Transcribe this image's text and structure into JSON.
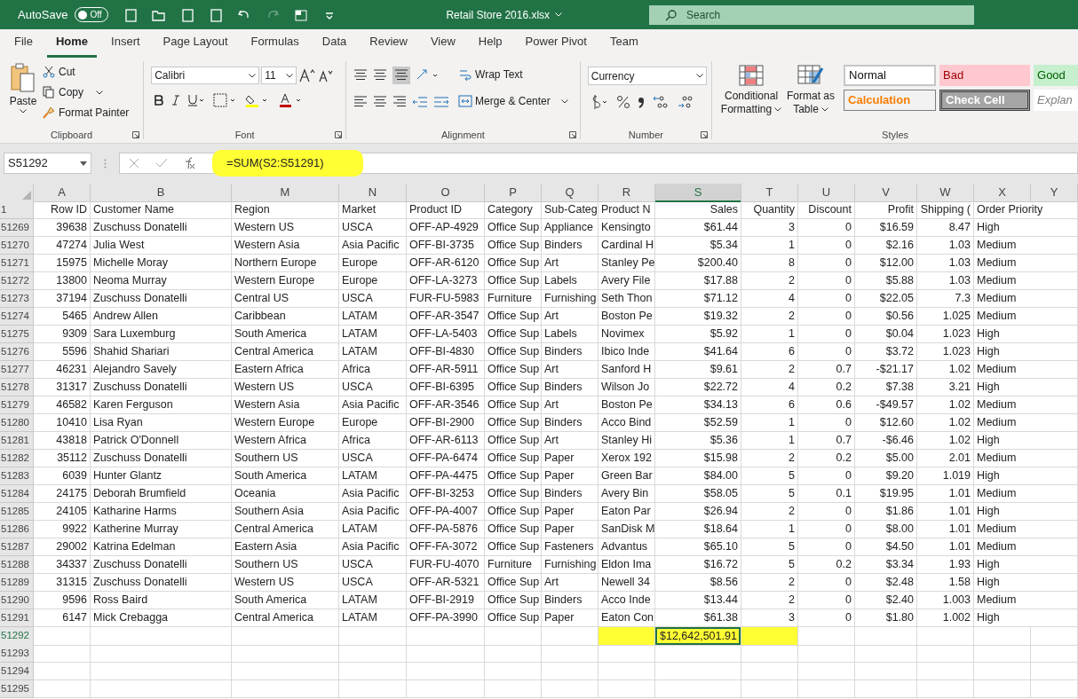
{
  "title_bar": {
    "autosave_label": "AutoSave",
    "autosave_on": false,
    "autosave_state": "Off",
    "title": "Retail Store 2016.xlsx",
    "search_placeholder": "Search"
  },
  "tabs": [
    {
      "label": "File",
      "selected": false
    },
    {
      "label": "Home",
      "selected": true
    },
    {
      "label": "Insert",
      "selected": false
    },
    {
      "label": "Page Layout",
      "selected": false
    },
    {
      "label": "Formulas",
      "selected": false
    },
    {
      "label": "Data",
      "selected": false
    },
    {
      "label": "Review",
      "selected": false
    },
    {
      "label": "View",
      "selected": false
    },
    {
      "label": "Help",
      "selected": false
    },
    {
      "label": "Power Pivot",
      "selected": false
    },
    {
      "label": "Team",
      "selected": false
    }
  ],
  "ribbon": {
    "clipboard": {
      "paste": "Paste",
      "cut": "Cut",
      "copy": "Copy",
      "format_painter": "Format Painter",
      "label": "Clipboard"
    },
    "font": {
      "font_name": "Calibri",
      "font_size": "11",
      "label": "Font"
    },
    "alignment": {
      "wrap_text": "Wrap Text",
      "merge": "Merge & Center",
      "label": "Alignment"
    },
    "number": {
      "format": "Currency",
      "label": "Number"
    },
    "styles": {
      "conditional": "Conditional Formatting",
      "format_table": "Format as Table",
      "label": "Styles",
      "cells": [
        {
          "label": "Normal",
          "kind": "normal"
        },
        {
          "label": "Bad",
          "kind": "bad"
        },
        {
          "label": "Good",
          "kind": "good"
        },
        {
          "label": "Calculation",
          "kind": "calculation"
        },
        {
          "label": "Check Cell",
          "kind": "check"
        },
        {
          "label": "Explan",
          "kind": "explanatory"
        }
      ]
    }
  },
  "formula_bar": {
    "name_box": "S51292",
    "formula": "=SUM(S2:S51291)"
  },
  "sheet": {
    "columns": [
      {
        "letter": "A",
        "kind": "numeric",
        "selected": false
      },
      {
        "letter": "B",
        "kind": "text",
        "selected": false
      },
      {
        "letter": "M",
        "kind": "text",
        "selected": false
      },
      {
        "letter": "N",
        "kind": "text",
        "selected": false
      },
      {
        "letter": "O",
        "kind": "text",
        "selected": false
      },
      {
        "letter": "P",
        "kind": "text",
        "selected": false
      },
      {
        "letter": "Q",
        "kind": "text",
        "selected": false
      },
      {
        "letter": "R",
        "kind": "text",
        "selected": false
      },
      {
        "letter": "S",
        "kind": "numeric",
        "selected": true
      },
      {
        "letter": "T",
        "kind": "numeric",
        "selected": false
      },
      {
        "letter": "U",
        "kind": "numeric",
        "selected": false
      },
      {
        "letter": "V",
        "kind": "numeric",
        "selected": false
      },
      {
        "letter": "W",
        "kind": "numeric",
        "selected": false
      },
      {
        "letter": "X",
        "kind": "text",
        "selected": false
      },
      {
        "letter": "Y",
        "kind": "text",
        "selected": false
      }
    ],
    "header_row": {
      "number": "1",
      "cells": [
        "Row ID",
        "Customer Name",
        "Region",
        "Market",
        "Product ID",
        "Category",
        "Sub-Categ",
        "Product N",
        "Sales",
        "Quantity",
        "Discount",
        "Profit",
        "Shipping (",
        "Order Priority"
      ]
    },
    "rows": [
      {
        "number": "51269",
        "cells": [
          "39638",
          "Zuschuss Donatelli",
          "Western US",
          "USCA",
          "OFF-AP-4929",
          "Office Sup",
          "Appliance",
          "Kensingto",
          "$61.44",
          "3",
          "0",
          "$16.59",
          "8.47",
          "High"
        ]
      },
      {
        "number": "51270",
        "cells": [
          "47274",
          "Julia West",
          "Western Asia",
          "Asia Pacific",
          "OFF-BI-3735",
          "Office Sup",
          "Binders",
          "Cardinal H",
          "$5.34",
          "1",
          "0",
          "$2.16",
          "1.03",
          "Medium"
        ]
      },
      {
        "number": "51271",
        "cells": [
          "15975",
          "Michelle Moray",
          "Northern Europe",
          "Europe",
          "OFF-AR-6120",
          "Office Sup",
          "Art",
          "Stanley Pe",
          "$200.40",
          "8",
          "0",
          "$12.00",
          "1.03",
          "Medium"
        ]
      },
      {
        "number": "51272",
        "cells": [
          "13800",
          "Neoma Murray",
          "Western Europe",
          "Europe",
          "OFF-LA-3273",
          "Office Sup",
          "Labels",
          "Avery File",
          "$17.88",
          "2",
          "0",
          "$5.88",
          "1.03",
          "Medium"
        ]
      },
      {
        "number": "51273",
        "cells": [
          "37194",
          "Zuschuss Donatelli",
          "Central US",
          "USCA",
          "FUR-FU-5983",
          "Furniture",
          "Furnishing",
          "Seth Thon",
          "$71.12",
          "4",
          "0",
          "$22.05",
          "7.3",
          "Medium"
        ]
      },
      {
        "number": "51274",
        "cells": [
          "5465",
          "Andrew Allen",
          "Caribbean",
          "LATAM",
          "OFF-AR-3547",
          "Office Sup",
          "Art",
          "Boston Pe",
          "$19.32",
          "2",
          "0",
          "$0.56",
          "1.025",
          "Medium"
        ]
      },
      {
        "number": "51275",
        "cells": [
          "9309",
          "Sara Luxemburg",
          "South America",
          "LATAM",
          "OFF-LA-5403",
          "Office Sup",
          "Labels",
          "Novimex",
          "$5.92",
          "1",
          "0",
          "$0.04",
          "1.023",
          "High"
        ]
      },
      {
        "number": "51276",
        "cells": [
          "5596",
          "Shahid Shariari",
          "Central America",
          "LATAM",
          "OFF-BI-4830",
          "Office Sup",
          "Binders",
          "Ibico Inde",
          "$41.64",
          "6",
          "0",
          "$3.72",
          "1.023",
          "High"
        ]
      },
      {
        "number": "51277",
        "cells": [
          "46231",
          "Alejandro Savely",
          "Eastern Africa",
          "Africa",
          "OFF-AR-5911",
          "Office Sup",
          "Art",
          "Sanford H",
          "$9.61",
          "2",
          "0.7",
          "-$21.17",
          "1.02",
          "Medium"
        ]
      },
      {
        "number": "51278",
        "cells": [
          "31317",
          "Zuschuss Donatelli",
          "Western US",
          "USCA",
          "OFF-BI-6395",
          "Office Sup",
          "Binders",
          "Wilson Jo",
          "$22.72",
          "4",
          "0.2",
          "$7.38",
          "3.21",
          "High"
        ]
      },
      {
        "number": "51279",
        "cells": [
          "46582",
          "Karen Ferguson",
          "Western Asia",
          "Asia Pacific",
          "OFF-AR-3546",
          "Office Sup",
          "Art",
          "Boston Pe",
          "$34.13",
          "6",
          "0.6",
          "-$49.57",
          "1.02",
          "Medium"
        ]
      },
      {
        "number": "51280",
        "cells": [
          "10410",
          "Lisa Ryan",
          "Western Europe",
          "Europe",
          "OFF-BI-2900",
          "Office Sup",
          "Binders",
          "Acco Bind",
          "$52.59",
          "1",
          "0",
          "$12.60",
          "1.02",
          "Medium"
        ]
      },
      {
        "number": "51281",
        "cells": [
          "43818",
          "Patrick O'Donnell",
          "Western Africa",
          "Africa",
          "OFF-AR-6113",
          "Office Sup",
          "Art",
          "Stanley Hi",
          "$5.36",
          "1",
          "0.7",
          "-$6.46",
          "1.02",
          "High"
        ]
      },
      {
        "number": "51282",
        "cells": [
          "35112",
          "Zuschuss Donatelli",
          "Southern US",
          "USCA",
          "OFF-PA-6474",
          "Office Sup",
          "Paper",
          "Xerox 192",
          "$15.98",
          "2",
          "0.2",
          "$5.00",
          "2.01",
          "Medium"
        ]
      },
      {
        "number": "51283",
        "cells": [
          "6039",
          "Hunter Glantz",
          "South America",
          "LATAM",
          "OFF-PA-4475",
          "Office Sup",
          "Paper",
          "Green Bar",
          "$84.00",
          "5",
          "0",
          "$9.20",
          "1.019",
          "High"
        ]
      },
      {
        "number": "51284",
        "cells": [
          "24175",
          "Deborah Brumfield",
          "Oceania",
          "Asia Pacific",
          "OFF-BI-3253",
          "Office Sup",
          "Binders",
          "Avery Bin",
          "$58.05",
          "5",
          "0.1",
          "$19.95",
          "1.01",
          "Medium"
        ]
      },
      {
        "number": "51285",
        "cells": [
          "24105",
          "Katharine Harms",
          "Southern Asia",
          "Asia Pacific",
          "OFF-PA-4007",
          "Office Sup",
          "Paper",
          "Eaton Par",
          "$26.94",
          "2",
          "0",
          "$1.86",
          "1.01",
          "High"
        ]
      },
      {
        "number": "51286",
        "cells": [
          "9922",
          "Katherine Murray",
          "Central America",
          "LATAM",
          "OFF-PA-5876",
          "Office Sup",
          "Paper",
          "SanDisk M",
          "$18.64",
          "1",
          "0",
          "$8.00",
          "1.01",
          "Medium"
        ]
      },
      {
        "number": "51287",
        "cells": [
          "29002",
          "Katrina Edelman",
          "Eastern Asia",
          "Asia Pacific",
          "OFF-FA-3072",
          "Office Sup",
          "Fasteners",
          "Advantus",
          "$65.10",
          "5",
          "0",
          "$4.50",
          "1.01",
          "Medium"
        ]
      },
      {
        "number": "51288",
        "cells": [
          "34337",
          "Zuschuss Donatelli",
          "Southern US",
          "USCA",
          "FUR-FU-4070",
          "Furniture",
          "Furnishing",
          "Eldon Ima",
          "$16.72",
          "5",
          "0.2",
          "$3.34",
          "1.93",
          "High"
        ]
      },
      {
        "number": "51289",
        "cells": [
          "31315",
          "Zuschuss Donatelli",
          "Western US",
          "USCA",
          "OFF-AR-5321",
          "Office Sup",
          "Art",
          "Newell 34",
          "$8.56",
          "2",
          "0",
          "$2.48",
          "1.58",
          "High"
        ]
      },
      {
        "number": "51290",
        "cells": [
          "9596",
          "Ross Baird",
          "South America",
          "LATAM",
          "OFF-BI-2919",
          "Office Sup",
          "Binders",
          "Acco Inde",
          "$13.44",
          "2",
          "0",
          "$2.40",
          "1.003",
          "Medium"
        ]
      },
      {
        "number": "51291",
        "cells": [
          "6147",
          "Mick Crebagga",
          "Central America",
          "LATAM",
          "OFF-PA-3990",
          "Office Sup",
          "Paper",
          "Eaton Con",
          "$61.38",
          "3",
          "0",
          "$1.80",
          "1.002",
          "High"
        ]
      }
    ],
    "total_row": {
      "number": "51292",
      "value": "$12,642,501.91",
      "selected": true
    },
    "empty_rows": [
      "51293",
      "51294",
      "51295"
    ]
  }
}
